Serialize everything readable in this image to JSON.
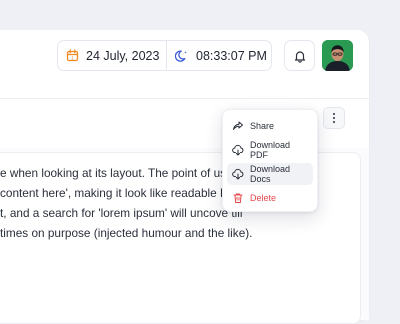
{
  "header": {
    "date": "24 July, 2023",
    "time": "08:33:07 PM"
  },
  "menu": {
    "items": [
      {
        "label": "Share",
        "icon": "share-icon"
      },
      {
        "label": "Download PDF",
        "icon": "cloud-download-icon"
      },
      {
        "label": "Download Docs",
        "icon": "cloud-download-icon"
      },
      {
        "label": "Delete",
        "icon": "trash-icon"
      }
    ]
  },
  "content": {
    "lines": [
      "e when looking at its layout. The point of usi",
      " content here', making it look like readable E          op",
      "t, and a search for 'lorem ipsum' will uncove           till",
      "times on purpose (injected humour and the like)."
    ]
  },
  "colors": {
    "accent_orange": "#f08a24",
    "accent_blue": "#3b5bdb",
    "danger": "#e5484d",
    "avatar_bg": "#2a9a52"
  }
}
